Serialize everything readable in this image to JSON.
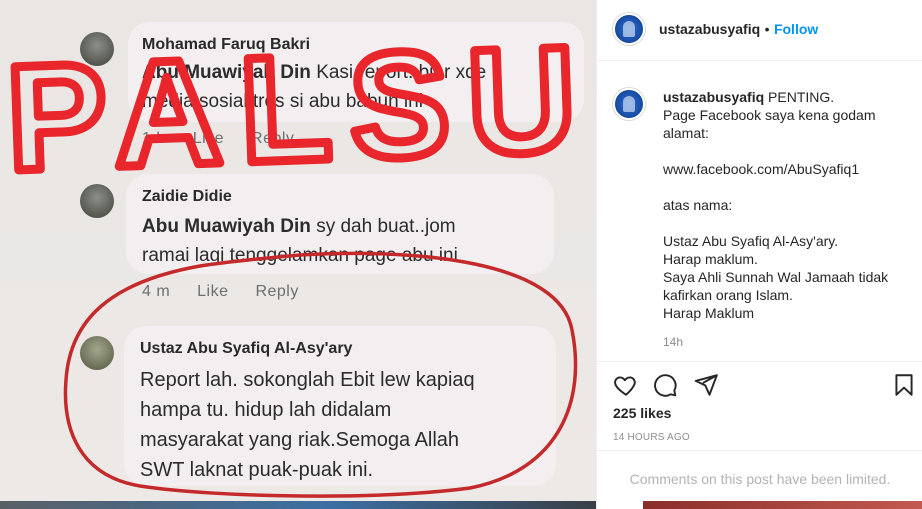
{
  "post": {
    "comments": [
      {
        "name": "Mohamad Faruq Bakri",
        "bold": "Abu Muawiyah Din",
        "text_lines": [
          "Kasi report..biar xde",
          "media sosial tros si abu babun ini"
        ],
        "meta": [
          "1 h",
          "Like",
          "Reply"
        ]
      },
      {
        "name": "Zaidie Didie",
        "bold": "Abu Muawiyah Din",
        "text_lines": [
          "sy dah buat..jom",
          "ramai lagi tenggelamkan page abu ini"
        ],
        "meta": [
          "4 m",
          "Like",
          "Reply"
        ]
      },
      {
        "name": "Ustaz Abu Syafiq Al-Asy'ary",
        "text_lines": [
          "Report lah. sokonglah Ebit lew kapiaq",
          "hampa tu. hidup lah didalam",
          "masyarakat yang riak.Semoga Allah",
          "SWT laknat puak-puak ini."
        ]
      }
    ],
    "overlay_text": "PALSU"
  },
  "panel": {
    "username": "ustazabusyafiq",
    "separator": "•",
    "follow_label": "Follow",
    "caption": {
      "username": "ustazabusyafiq",
      "first_line": "PENTING.",
      "lines": [
        "Page Facebook saya kena godam",
        "alamat:",
        "",
        "www.facebook.com/AbuSyafiq1",
        "",
        "atas nama:",
        "",
        "Ustaz Abu Syafiq Al-Asy'ary.",
        "Harap maklum.",
        "Saya Ahli Sunnah Wal Jamaah tidak",
        "kafirkan orang Islam.",
        "Harap Maklum"
      ],
      "time": "14h"
    },
    "likes": "225 likes",
    "post_date": "14 HOURS AGO",
    "comments_limited": "Comments on this post have been limited.",
    "icons": [
      "heart-icon",
      "comment-icon",
      "share-icon",
      "bookmark-icon"
    ]
  },
  "colors": {
    "palsu_red": "#e8262b",
    "follow_blue": "#0095f6"
  }
}
